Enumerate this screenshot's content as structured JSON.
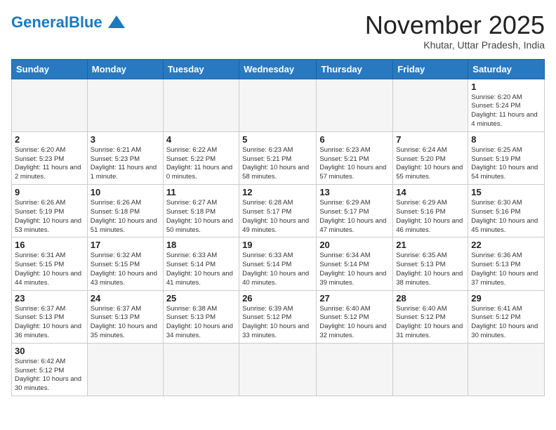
{
  "logo": {
    "text_general": "General",
    "text_blue": "Blue"
  },
  "title": "November 2025",
  "subtitle": "Khutar, Uttar Pradesh, India",
  "days_header": [
    "Sunday",
    "Monday",
    "Tuesday",
    "Wednesday",
    "Thursday",
    "Friday",
    "Saturday"
  ],
  "weeks": [
    [
      {
        "day": "",
        "info": ""
      },
      {
        "day": "",
        "info": ""
      },
      {
        "day": "",
        "info": ""
      },
      {
        "day": "",
        "info": ""
      },
      {
        "day": "",
        "info": ""
      },
      {
        "day": "",
        "info": ""
      },
      {
        "day": "1",
        "info": "Sunrise: 6:20 AM\nSunset: 5:24 PM\nDaylight: 11 hours and 4 minutes."
      }
    ],
    [
      {
        "day": "2",
        "info": "Sunrise: 6:20 AM\nSunset: 5:23 PM\nDaylight: 11 hours and 2 minutes."
      },
      {
        "day": "3",
        "info": "Sunrise: 6:21 AM\nSunset: 5:23 PM\nDaylight: 11 hours and 1 minute."
      },
      {
        "day": "4",
        "info": "Sunrise: 6:22 AM\nSunset: 5:22 PM\nDaylight: 11 hours and 0 minutes."
      },
      {
        "day": "5",
        "info": "Sunrise: 6:23 AM\nSunset: 5:21 PM\nDaylight: 10 hours and 58 minutes."
      },
      {
        "day": "6",
        "info": "Sunrise: 6:23 AM\nSunset: 5:21 PM\nDaylight: 10 hours and 57 minutes."
      },
      {
        "day": "7",
        "info": "Sunrise: 6:24 AM\nSunset: 5:20 PM\nDaylight: 10 hours and 55 minutes."
      },
      {
        "day": "8",
        "info": "Sunrise: 6:25 AM\nSunset: 5:19 PM\nDaylight: 10 hours and 54 minutes."
      }
    ],
    [
      {
        "day": "9",
        "info": "Sunrise: 6:26 AM\nSunset: 5:19 PM\nDaylight: 10 hours and 53 minutes."
      },
      {
        "day": "10",
        "info": "Sunrise: 6:26 AM\nSunset: 5:18 PM\nDaylight: 10 hours and 51 minutes."
      },
      {
        "day": "11",
        "info": "Sunrise: 6:27 AM\nSunset: 5:18 PM\nDaylight: 10 hours and 50 minutes."
      },
      {
        "day": "12",
        "info": "Sunrise: 6:28 AM\nSunset: 5:17 PM\nDaylight: 10 hours and 49 minutes."
      },
      {
        "day": "13",
        "info": "Sunrise: 6:29 AM\nSunset: 5:17 PM\nDaylight: 10 hours and 47 minutes."
      },
      {
        "day": "14",
        "info": "Sunrise: 6:29 AM\nSunset: 5:16 PM\nDaylight: 10 hours and 46 minutes."
      },
      {
        "day": "15",
        "info": "Sunrise: 6:30 AM\nSunset: 5:16 PM\nDaylight: 10 hours and 45 minutes."
      }
    ],
    [
      {
        "day": "16",
        "info": "Sunrise: 6:31 AM\nSunset: 5:15 PM\nDaylight: 10 hours and 44 minutes."
      },
      {
        "day": "17",
        "info": "Sunrise: 6:32 AM\nSunset: 5:15 PM\nDaylight: 10 hours and 43 minutes."
      },
      {
        "day": "18",
        "info": "Sunrise: 6:33 AM\nSunset: 5:14 PM\nDaylight: 10 hours and 41 minutes."
      },
      {
        "day": "19",
        "info": "Sunrise: 6:33 AM\nSunset: 5:14 PM\nDaylight: 10 hours and 40 minutes."
      },
      {
        "day": "20",
        "info": "Sunrise: 6:34 AM\nSunset: 5:14 PM\nDaylight: 10 hours and 39 minutes."
      },
      {
        "day": "21",
        "info": "Sunrise: 6:35 AM\nSunset: 5:13 PM\nDaylight: 10 hours and 38 minutes."
      },
      {
        "day": "22",
        "info": "Sunrise: 6:36 AM\nSunset: 5:13 PM\nDaylight: 10 hours and 37 minutes."
      }
    ],
    [
      {
        "day": "23",
        "info": "Sunrise: 6:37 AM\nSunset: 5:13 PM\nDaylight: 10 hours and 36 minutes."
      },
      {
        "day": "24",
        "info": "Sunrise: 6:37 AM\nSunset: 5:13 PM\nDaylight: 10 hours and 35 minutes."
      },
      {
        "day": "25",
        "info": "Sunrise: 6:38 AM\nSunset: 5:13 PM\nDaylight: 10 hours and 34 minutes."
      },
      {
        "day": "26",
        "info": "Sunrise: 6:39 AM\nSunset: 5:12 PM\nDaylight: 10 hours and 33 minutes."
      },
      {
        "day": "27",
        "info": "Sunrise: 6:40 AM\nSunset: 5:12 PM\nDaylight: 10 hours and 32 minutes."
      },
      {
        "day": "28",
        "info": "Sunrise: 6:40 AM\nSunset: 5:12 PM\nDaylight: 10 hours and 31 minutes."
      },
      {
        "day": "29",
        "info": "Sunrise: 6:41 AM\nSunset: 5:12 PM\nDaylight: 10 hours and 30 minutes."
      }
    ],
    [
      {
        "day": "30",
        "info": "Sunrise: 6:42 AM\nSunset: 5:12 PM\nDaylight: 10 hours and 30 minutes."
      },
      {
        "day": "",
        "info": ""
      },
      {
        "day": "",
        "info": ""
      },
      {
        "day": "",
        "info": ""
      },
      {
        "day": "",
        "info": ""
      },
      {
        "day": "",
        "info": ""
      },
      {
        "day": "",
        "info": ""
      }
    ]
  ]
}
